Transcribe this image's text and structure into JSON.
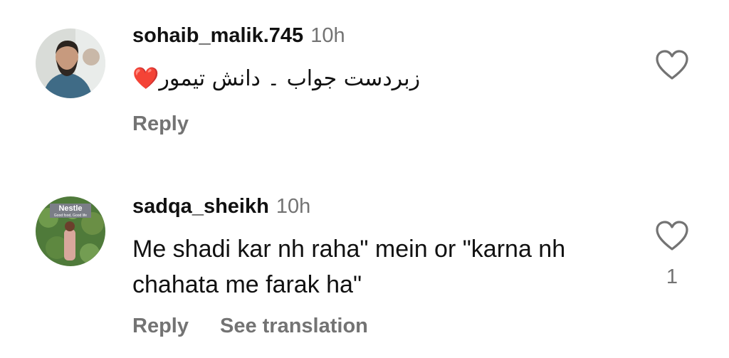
{
  "comments": [
    {
      "username": "sohaib_malik.745",
      "time": "10h",
      "text": "زبردست جواب ۔ دانش تیمور",
      "emoji": "❤️",
      "reply_label": "Reply",
      "like_count": ""
    },
    {
      "username": "sadqa_sheikh",
      "time": "10h",
      "text": "Me shadi kar nh raha\" mein or \"karna nh chahata me farak ha\"",
      "avatar_brand": "Nestle",
      "avatar_tagline": "Good food, Good life",
      "reply_label": "Reply",
      "translate_label": "See translation",
      "like_count": "1"
    }
  ],
  "colors": {
    "text": "#111111",
    "secondary": "#737373",
    "heart": "#e0282e"
  }
}
